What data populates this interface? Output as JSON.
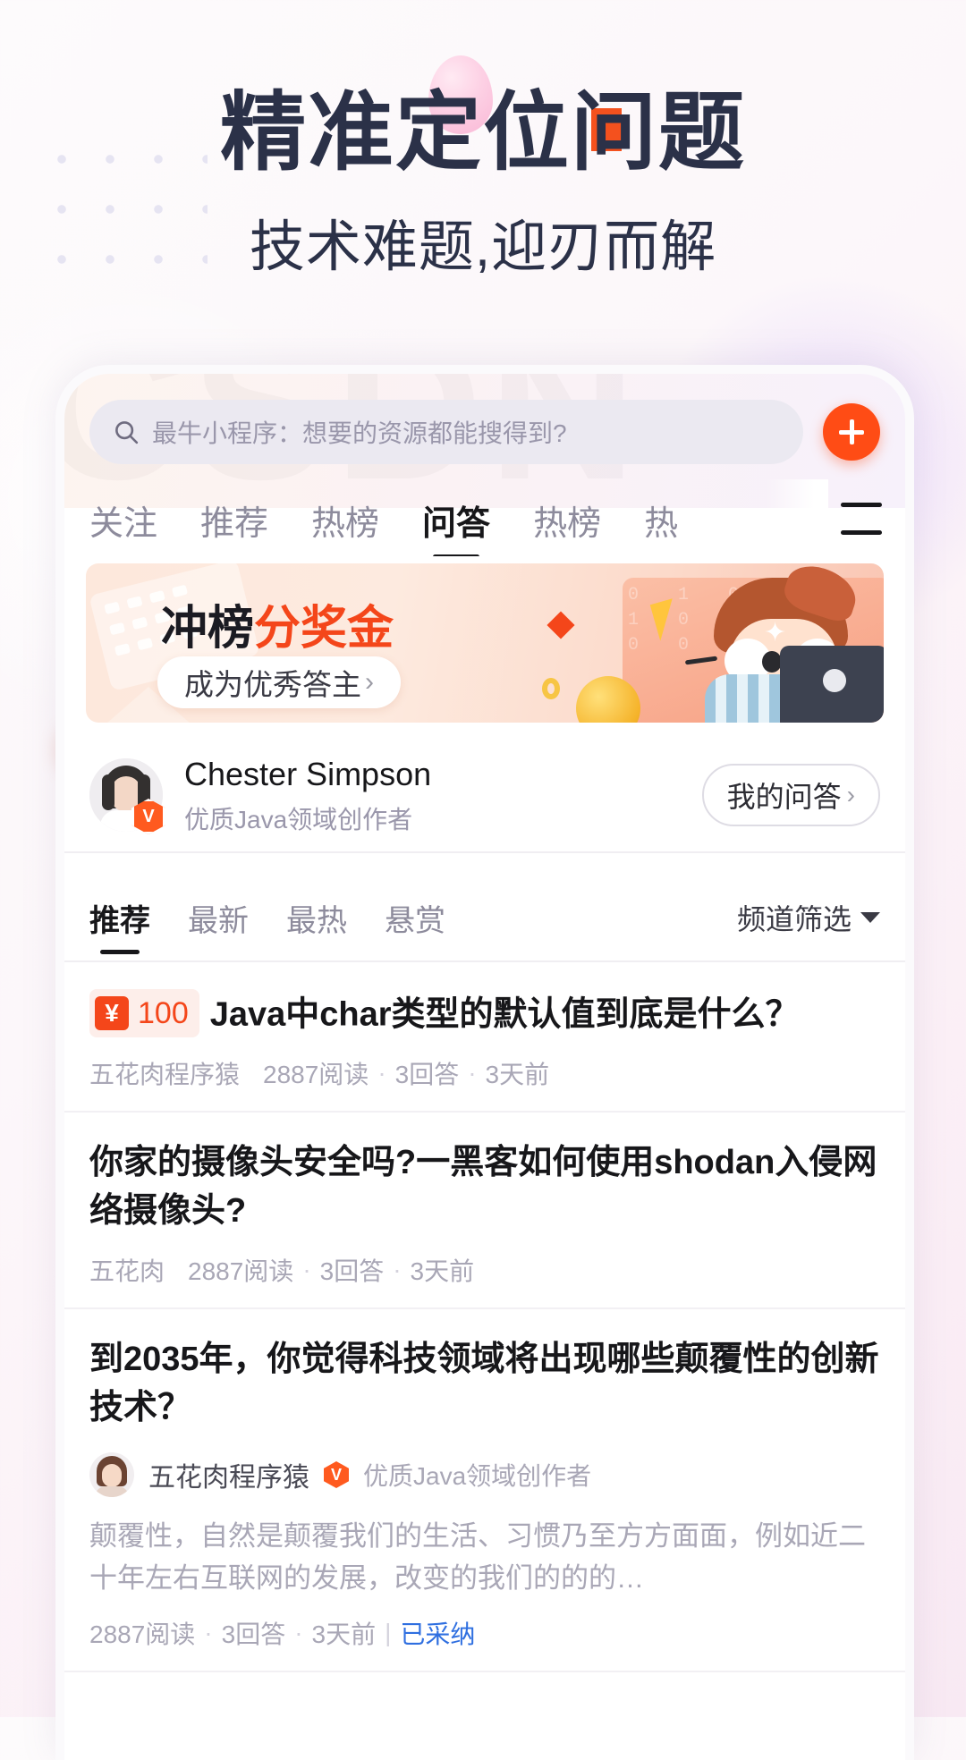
{
  "hero": {
    "title_pre": "精准定",
    "title_accent_char": "位问",
    "title_full": "精准定位问题",
    "title_part_a": "精准定",
    "title_part_b": "位",
    "title_part_c": "问",
    "title_part_d": "题",
    "subtitle": "技术难题,迎刃而解",
    "accent_color": "#f4511e",
    "text_color": "#2b3148"
  },
  "app": {
    "watermark": "CSDN",
    "search": {
      "icon": "search-icon",
      "placeholder": "最牛小程序：想要的资源都能搜得到?",
      "value": ""
    },
    "add_button": {
      "icon": "plus-icon",
      "color": "#ff4c15"
    },
    "channel_tabs": [
      {
        "label": "关注",
        "active": false
      },
      {
        "label": "推荐",
        "active": false
      },
      {
        "label": "热榜",
        "active": false
      },
      {
        "label": "问答",
        "active": true
      },
      {
        "label": "热榜",
        "active": false
      },
      {
        "label": "热",
        "active": false
      }
    ],
    "channel_menu_icon": "hamburger-menu-icon",
    "banner": {
      "title_dark": "冲榜",
      "title_accent": "分奖金",
      "cta_label": "成为优秀答主",
      "cta_chevron": "›",
      "accent_color": "#f4461a",
      "bits": "0 1 0  1 0 1  0 0 1  1 0 0"
    },
    "profile": {
      "name": "Chester Simpson",
      "description": "优质Java领域创作者",
      "verified_badge": "V",
      "action_label": "我的问答",
      "action_chevron": "›"
    },
    "filters": {
      "tabs": [
        {
          "label": "推荐",
          "active": true
        },
        {
          "label": "最新",
          "active": false
        },
        {
          "label": "最热",
          "active": false
        },
        {
          "label": "悬赏",
          "active": false
        }
      ],
      "channel_filter_label": "频道筛选"
    },
    "questions": [
      {
        "bounty_symbol": "¥",
        "bounty_amount": "100",
        "title": "Java中char类型的默认值到底是什么？",
        "author": "五花肉程序猿",
        "reads": "2887阅读",
        "answers": "3回答",
        "time": "3天前"
      },
      {
        "bounty_amount": "",
        "title": "你家的摄像头安全吗?一黑客如何使用shodan入侵网络摄像头?",
        "author": "五花肉",
        "reads": "2887阅读",
        "answers": "3回答",
        "time": "3天前"
      },
      {
        "bounty_amount": "",
        "title": "到2035年，你觉得科技领域将出现哪些颠覆性的创新技术？",
        "author": "五花肉程序猿",
        "author_badge": "V",
        "author_desc": "优质Java领域创作者",
        "excerpt": "颠覆性，自然是颠覆我们的生活、习惯乃至方方面面，例如近二十年左右互联网的发展，改变的我们的的的…",
        "reads": "2887阅读",
        "answers": "3回答",
        "time": "3天前",
        "status": "已采纳",
        "status_color": "#2f6fe0"
      }
    ]
  }
}
